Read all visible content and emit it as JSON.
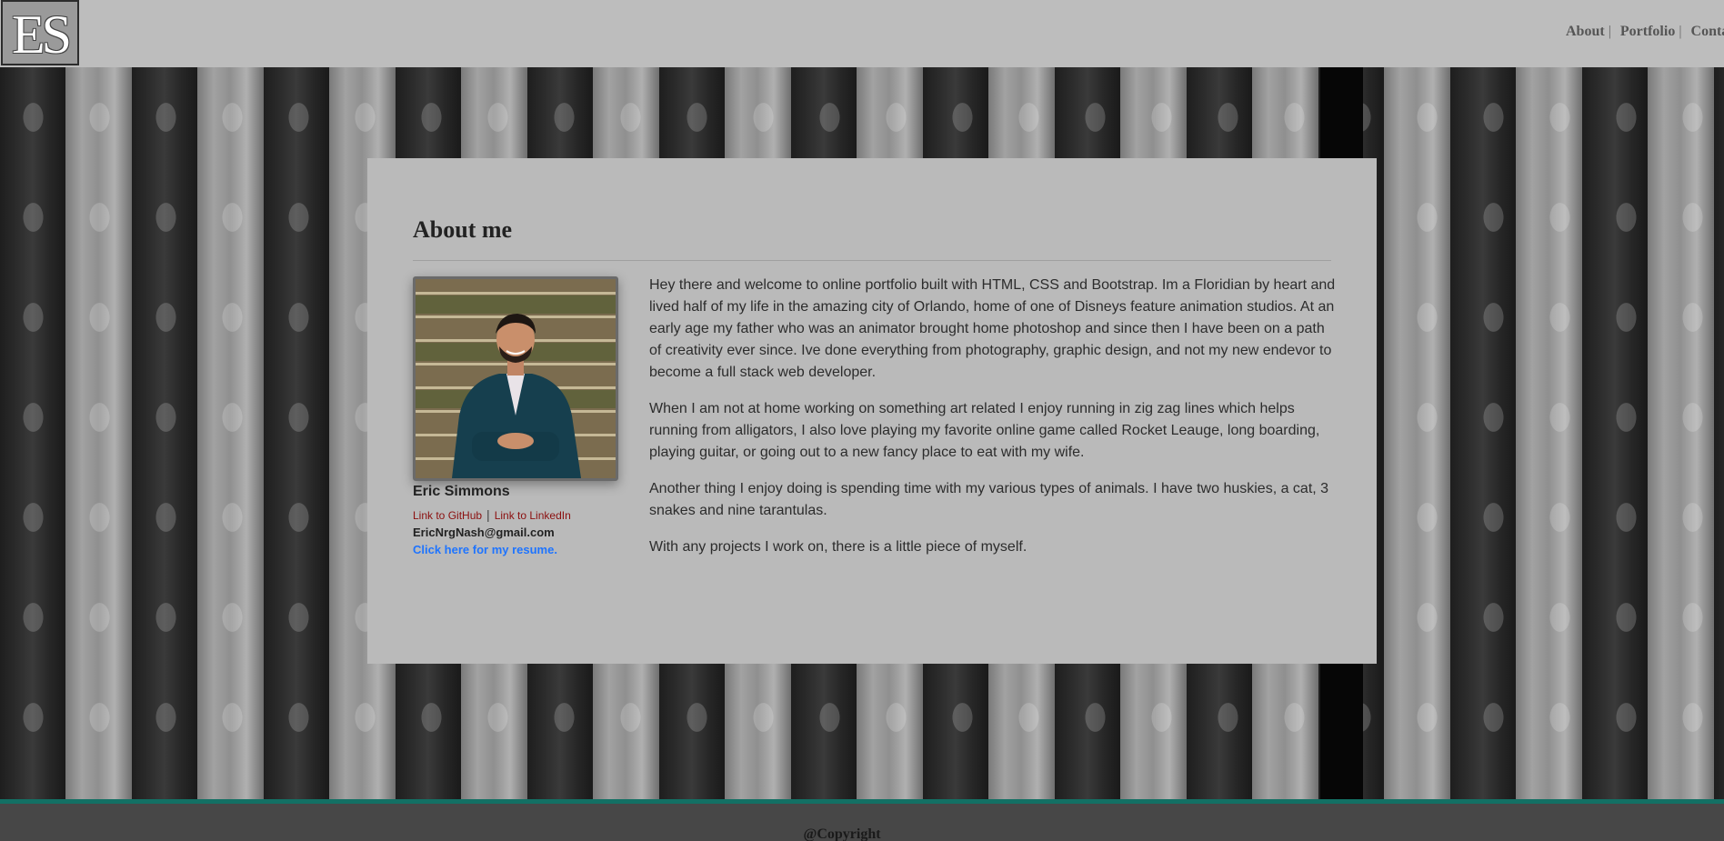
{
  "header": {
    "logo_text": "ES",
    "nav": [
      {
        "label": "About"
      },
      {
        "label": "Portfolio"
      },
      {
        "label": "Contact"
      }
    ],
    "separator": "|"
  },
  "about": {
    "title": "About me",
    "profile": {
      "name": "Eric Simmons",
      "github_link": "Link to GitHub",
      "linkedin_link": "Link to LinkedIn",
      "link_separator": "|",
      "email": "EricNrgNash@gmail.com",
      "resume_link": "Click here for my resume."
    },
    "paragraphs": [
      "Hey there and welcome to online portfolio built with HTML, CSS and Bootstrap. Im a Floridian by heart and lived half of my life in the amazing city of Orlando, home of one of Disneys feature animation studios. At an early age my father who was an animator brought home photoshop and since then I have been on a path of creativity ever since. Ive done everything from photography, graphic design, and not my new endevor to become a full stack web developer.",
      "When I am not at home working on something art related I enjoy running in zig zag lines which helps running from alligators, I also love playing my favorite online game called Rocket Leauge, long boarding, playing guitar, or going out to a new fancy place to eat with my wife.",
      "Another thing I enjoy doing is spending time with my various types of animals. I have two huskies, a cat, 3 snakes and nine tarantulas.",
      "With any projects I work on, there is a little piece of myself."
    ]
  },
  "footer": {
    "copyright": "@Copyright"
  },
  "colors": {
    "header_bg": "#bdbdbd",
    "card_bg": "#bababa",
    "footer_bg": "#474747",
    "footer_accent": "#137064",
    "link_red": "#8b0f0f",
    "link_blue": "#1e74ff"
  },
  "icons": {
    "profile_photo": "person-in-suit-photo"
  }
}
